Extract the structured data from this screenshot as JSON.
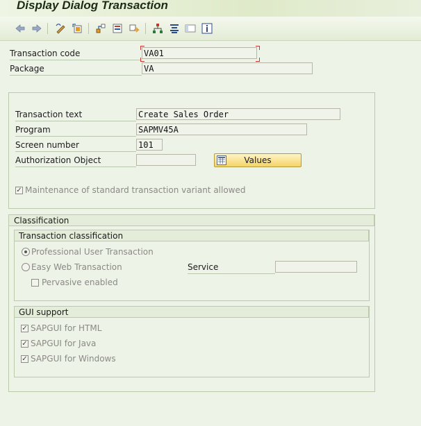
{
  "window": {
    "title": "Display Dialog Transaction"
  },
  "toolbar": {
    "icons": [
      "back-arrow-icon",
      "forward-arrow-icon",
      "display-change-icon",
      "other-object-icon",
      "where-used-icon",
      "object-list-icon",
      "transport-icon",
      "hierarchy-icon",
      "documentation-icon",
      "layout-icon",
      "information-icon"
    ]
  },
  "header": {
    "tcode_label": "Transaction code",
    "tcode_value": "VA01",
    "package_label": "Package",
    "package_value": "VA"
  },
  "main": {
    "text_label": "Transaction text",
    "text_value": "Create Sales Order",
    "program_label": "Program",
    "program_value": "SAPMV45A",
    "screen_label": "Screen number",
    "screen_value": "101",
    "auth_label": "Authorization Object",
    "auth_value": "",
    "values_button": "Values",
    "variant_checkbox": "Maintenance of standard transaction variant allowed",
    "variant_checked": true
  },
  "classification": {
    "title": "Classification",
    "tx_class_title": "Transaction classification",
    "professional_label": "Professional User Transaction",
    "professional_selected": true,
    "easyweb_label": "Easy Web Transaction",
    "easyweb_selected": false,
    "service_label": "Service",
    "service_value": "",
    "pervasive_label": "Pervasive enabled",
    "pervasive_checked": false,
    "gui_title": "GUI support",
    "html_label": "SAPGUI for HTML",
    "java_label": "SAPGUI for Java",
    "windows_label": "SAPGUI for Windows",
    "html_checked": true,
    "java_checked": true,
    "windows_checked": true
  },
  "colors": {
    "accent": "#f4d467",
    "background": "#eef3e8",
    "required_corner": "#d0342c"
  }
}
